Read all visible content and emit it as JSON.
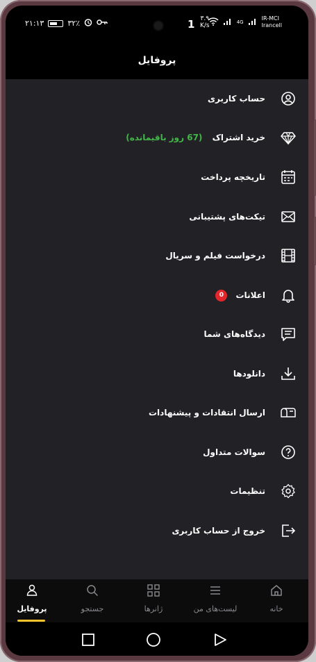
{
  "status_bar": {
    "time": "۲۱:۱۳",
    "battery_percent": "۳۲٪",
    "speed_value": "۳.۹",
    "speed_unit": "K/s",
    "speed_digit": "1",
    "network_type": "4G",
    "carrier_1": "IR-MCI",
    "carrier_2": "Irancell"
  },
  "header": {
    "title": "پروفایل"
  },
  "menu": {
    "items": [
      {
        "label": "حساب کاربری",
        "icon": "account-circle-icon"
      },
      {
        "label": "خرید اشتراک",
        "extra": "(67 روز باقیمانده)",
        "icon": "diamond-icon"
      },
      {
        "label": "تاریخچه پرداخت",
        "icon": "calendar-icon"
      },
      {
        "label": "تیکت‌های پشتیبانی",
        "icon": "mail-icon"
      },
      {
        "label": "درخواست فیلم و سریال",
        "icon": "film-icon"
      },
      {
        "label": "اعلانات",
        "badge": "0",
        "icon": "bell-icon"
      },
      {
        "label": "دیدگاه‌های شما",
        "icon": "comment-icon"
      },
      {
        "label": "دانلودها",
        "icon": "download-icon"
      },
      {
        "label": "ارسال انتقادات و پیشنهادات",
        "icon": "mailbox-icon"
      },
      {
        "label": "سوالات متداول",
        "icon": "question-icon"
      },
      {
        "label": "تنظیمات",
        "icon": "gear-icon"
      },
      {
        "label": "خروج از حساب کاربری",
        "icon": "logout-icon"
      }
    ]
  },
  "bottom_nav": {
    "items": [
      {
        "label": "پروفایل",
        "icon": "user-icon",
        "active": true
      },
      {
        "label": "جستجو",
        "icon": "search-icon"
      },
      {
        "label": "ژانرها",
        "icon": "grid-icon"
      },
      {
        "label": "لیست‌های من",
        "icon": "list-icon"
      },
      {
        "label": "خانه",
        "icon": "home-icon"
      }
    ]
  },
  "colors": {
    "accent": "#f7c52b",
    "success_text": "#43b649",
    "badge": "#e3262b",
    "menu_bg": "#222226"
  }
}
